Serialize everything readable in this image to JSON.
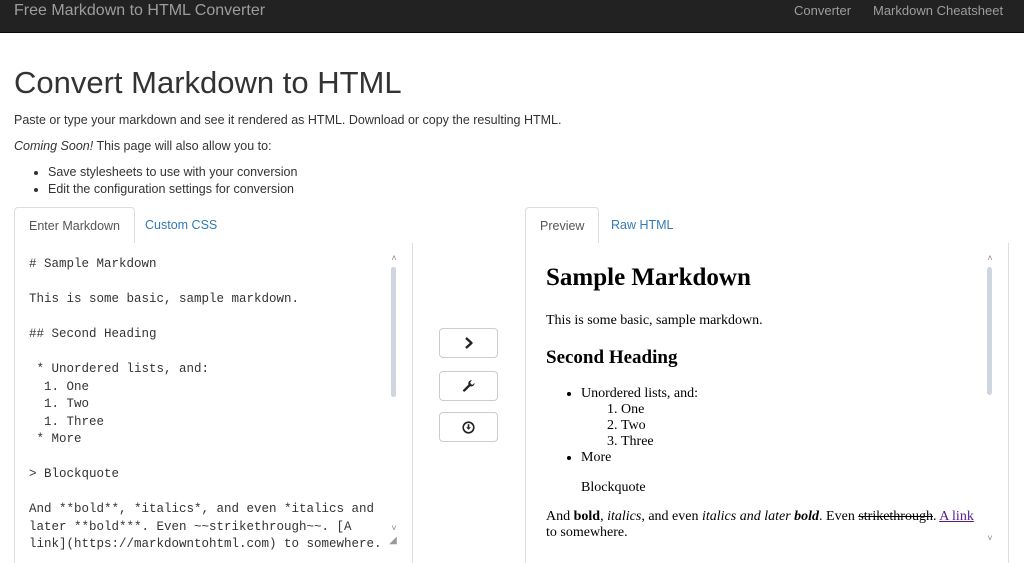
{
  "navbar": {
    "brand": "Free Markdown to HTML Converter",
    "links": [
      {
        "label": "Converter"
      },
      {
        "label": "Markdown Cheatsheet"
      }
    ]
  },
  "header": {
    "title": "Convert Markdown to HTML",
    "intro": "Paste or type your markdown and see it rendered as HTML. Download or copy the resulting HTML.",
    "coming_soon_em": "Coming Soon!",
    "coming_soon_text": " This page will also allow you to:",
    "features": [
      "Save stylesheets to use with your conversion",
      "Edit the configuration settings for conversion"
    ]
  },
  "left_tabs": [
    {
      "label": "Enter Markdown",
      "active": true
    },
    {
      "label": "Custom CSS",
      "active": false
    }
  ],
  "right_tabs": [
    {
      "label": "Preview",
      "active": true
    },
    {
      "label": "Raw HTML",
      "active": false
    }
  ],
  "editor": {
    "value": "# Sample Markdown\n\nThis is some basic, sample markdown.\n\n## Second Heading\n\n * Unordered lists, and:\n  1. One\n  1. Two\n  1. Three\n * More\n\n> Blockquote\n\nAnd **bold**, *italics*, and even *italics and\nlater **bold***. Even ~~strikethrough~~. [A\nlink](https://markdowntohtml.com) to somewhere."
  },
  "actions": {
    "convert_icon": "chevron-right-icon",
    "settings_icon": "wrench-icon",
    "download_icon": "download-circle-icon"
  },
  "preview": {
    "h1": "Sample Markdown",
    "p1": "This is some basic, sample markdown.",
    "h2": "Second Heading",
    "list_item_1": "Unordered lists, and:",
    "ordered": [
      "One",
      "Two",
      "Three"
    ],
    "list_item_2": "More",
    "blockquote": "Blockquote",
    "p2": {
      "t1": "And ",
      "bold": "bold",
      "t2": ", ",
      "italics": "italics",
      "t3": ", and even ",
      "italics_later": "italics and later ",
      "bold_italic": "bold",
      "t4": ". Even ",
      "strike": "strikethrough",
      "t5": ". ",
      "link": "A link",
      "t6": " to somewhere."
    }
  },
  "colors": {
    "navbar_bg": "#222222",
    "link": "#337ab7",
    "visited_link": "#551a8b"
  }
}
